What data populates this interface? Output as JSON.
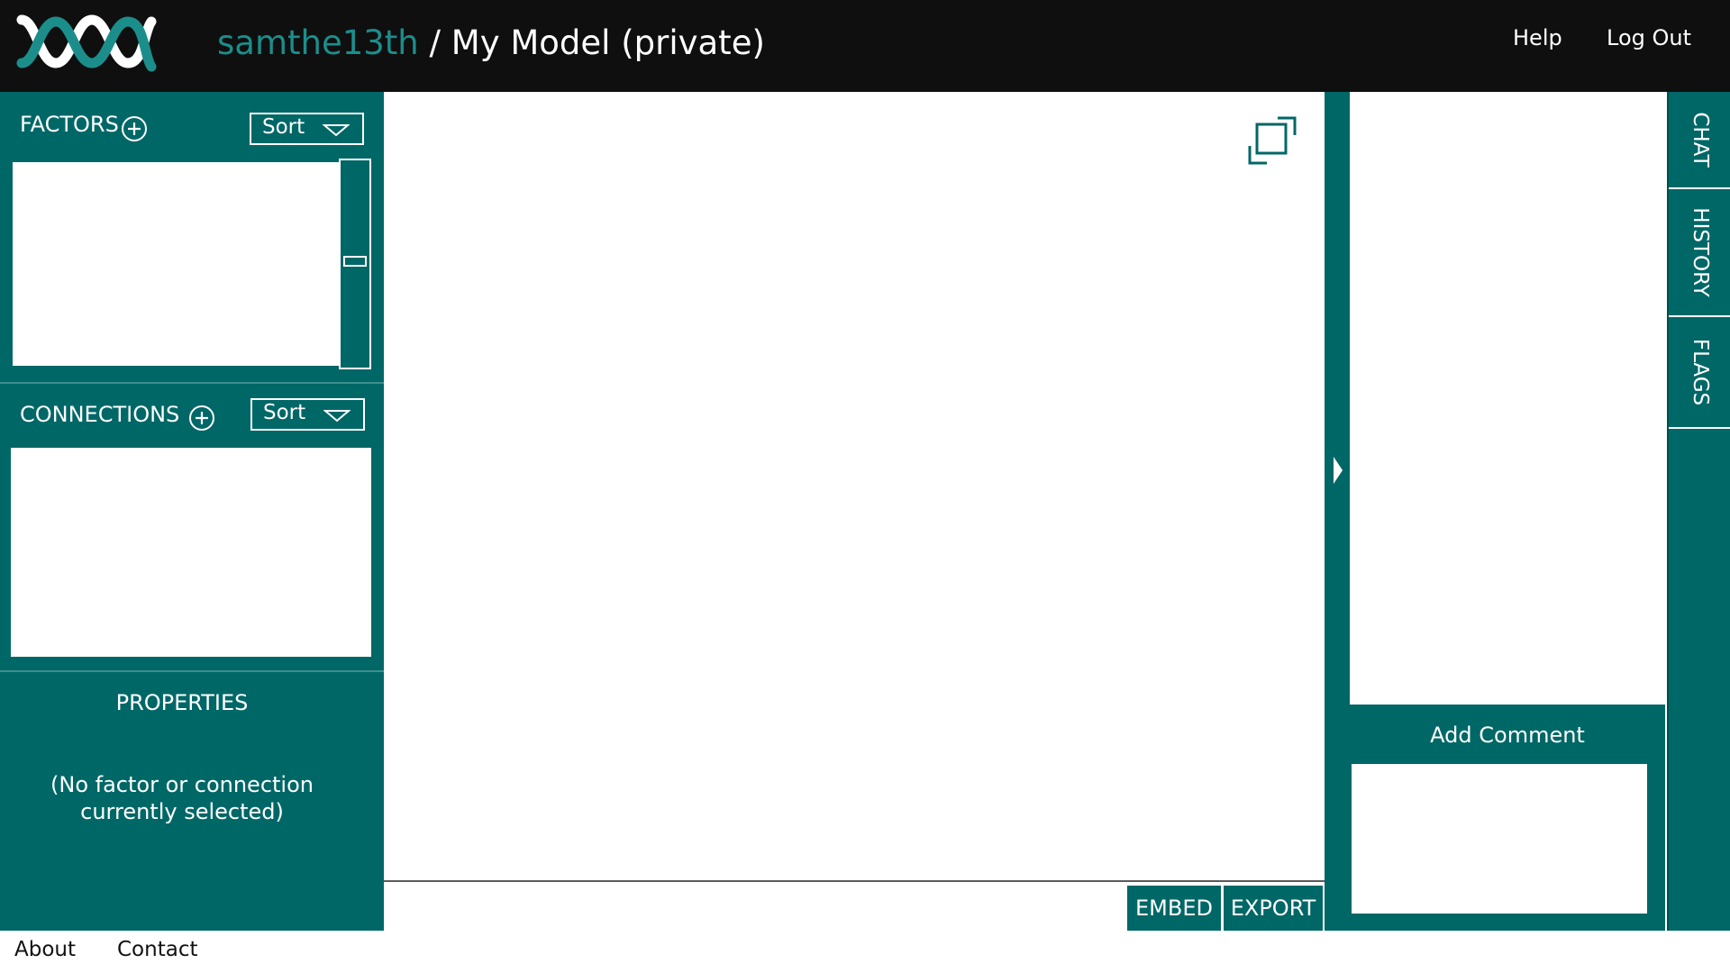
{
  "header": {
    "username": "samthe13th",
    "separator": " / ",
    "model_title": "My Model (private)",
    "links": {
      "help": "Help",
      "logout": "Log Out"
    }
  },
  "factors": {
    "label": "FACTORS",
    "sort_label": "Sort",
    "add_icon": "plus-circle-icon"
  },
  "connections": {
    "label": "CONNECTIONS",
    "sort_label": "Sort",
    "add_icon": "plus-circle-icon"
  },
  "properties": {
    "title": "PROPERTIES",
    "empty_message": "(No factor or connection currently selected)"
  },
  "canvas": {
    "fullscreen_icon": "expand-icon",
    "buttons": {
      "embed": "EMBED",
      "export": "EXPORT"
    }
  },
  "comments": {
    "add_label": "Add Comment",
    "collapse_icon": "caret-right-icon"
  },
  "side_tabs": [
    "CHAT",
    "HISTORY",
    "FLAGS"
  ],
  "footer": {
    "about": "About",
    "contact": "Contact"
  },
  "colors": {
    "accent": "#006767",
    "header_bg": "#0f0f0f",
    "username": "#1b8e8c"
  }
}
